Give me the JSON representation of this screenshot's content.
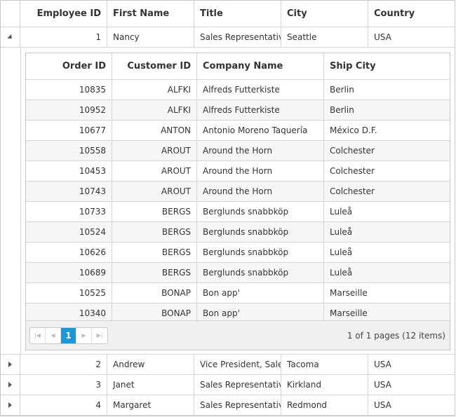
{
  "employees": {
    "headers": {
      "employee_id": "Employee ID",
      "first_name": "First Name",
      "title": "Title",
      "city": "City",
      "country": "Country"
    },
    "rows": [
      {
        "id": "1",
        "first": "Nancy",
        "title": "Sales Representative",
        "city": "Seattle",
        "country": "USA",
        "expanded": true
      },
      {
        "id": "2",
        "first": "Andrew",
        "title": "Vice President, Sales",
        "city": "Tacoma",
        "country": "USA",
        "expanded": false
      },
      {
        "id": "3",
        "first": "Janet",
        "title": "Sales Representative",
        "city": "Kirkland",
        "country": "USA",
        "expanded": false
      },
      {
        "id": "4",
        "first": "Margaret",
        "title": "Sales Representative",
        "city": "Redmond",
        "country": "USA",
        "expanded": false
      }
    ]
  },
  "orders": {
    "headers": {
      "order_id": "Order ID",
      "customer_id": "Customer ID",
      "company": "Company Name",
      "ship_city": "Ship City"
    },
    "rows": [
      {
        "order": "10835",
        "customer": "ALFKI",
        "company": "Alfreds Futterkiste",
        "ship": "Berlin"
      },
      {
        "order": "10952",
        "customer": "ALFKI",
        "company": "Alfreds Futterkiste",
        "ship": "Berlin"
      },
      {
        "order": "10677",
        "customer": "ANTON",
        "company": "Antonio Moreno Taquería",
        "ship": "México D.F."
      },
      {
        "order": "10558",
        "customer": "AROUT",
        "company": "Around the Horn",
        "ship": "Colchester"
      },
      {
        "order": "10453",
        "customer": "AROUT",
        "company": "Around the Horn",
        "ship": "Colchester"
      },
      {
        "order": "10743",
        "customer": "AROUT",
        "company": "Around the Horn",
        "ship": "Colchester"
      },
      {
        "order": "10733",
        "customer": "BERGS",
        "company": "Berglunds snabbköp",
        "ship": "Luleå"
      },
      {
        "order": "10524",
        "customer": "BERGS",
        "company": "Berglunds snabbköp",
        "ship": "Luleå"
      },
      {
        "order": "10626",
        "customer": "BERGS",
        "company": "Berglunds snabbköp",
        "ship": "Luleå"
      },
      {
        "order": "10689",
        "customer": "BERGS",
        "company": "Berglunds snabbköp",
        "ship": "Luleå"
      },
      {
        "order": "10525",
        "customer": "BONAP",
        "company": "Bon app'",
        "ship": "Marseille"
      },
      {
        "order": "10340",
        "customer": "BONAP",
        "company": "Bon app'",
        "ship": "Marseille"
      }
    ]
  },
  "pager": {
    "first_icon": "first-page-icon",
    "prev_icon": "prev-page-icon",
    "current_page": "1",
    "next_icon": "next-page-icon",
    "last_icon": "last-page-icon",
    "info": "1 of 1 pages (12 items)"
  },
  "colors": {
    "accent": "#1a96d9",
    "alt_row": "#f6f6f6",
    "border": "#d5d5d5",
    "pager_bg": "#f0f0f0"
  }
}
